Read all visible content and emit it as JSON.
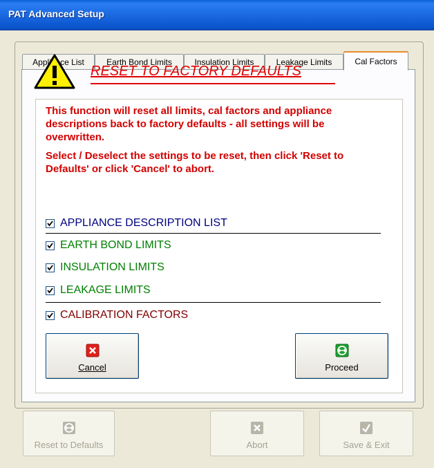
{
  "window": {
    "title": "PAT Advanced Setup"
  },
  "tabs": [
    {
      "label": "Appliance List",
      "active": false
    },
    {
      "label": "Earth Bond Limits",
      "active": false
    },
    {
      "label": "Insulation Limits",
      "active": false
    },
    {
      "label": "Leakage Limits",
      "active": false
    },
    {
      "label": "Cal Factors",
      "active": true
    }
  ],
  "panel": {
    "heading": "RESET TO FACTORY DEFAULTS",
    "message1": "This function will reset all limits, cal factors and appliance descriptions back to factory defaults - all settings will be overwritten.",
    "message2": "Select / Deselect the settings to be reset, then click 'Reset to Defaults' or click 'Cancel' to abort.",
    "options": [
      {
        "label": "APPLIANCE DESCRIPTION LIST",
        "checked": true,
        "color": "#000080"
      },
      {
        "label": "EARTH BOND LIMITS",
        "checked": true,
        "color": "#008000"
      },
      {
        "label": "INSULATION LIMITS",
        "checked": true,
        "color": "#008000"
      },
      {
        "label": "LEAKAGE LIMITS",
        "checked": true,
        "color": "#008000"
      },
      {
        "label": "CALIBRATION FACTORS",
        "checked": true,
        "color": "#800000"
      }
    ],
    "cancel_label": "Cancel",
    "proceed_label": "Proceed"
  },
  "footer": {
    "reset_label": "Reset to Defaults",
    "abort_label": "Abort",
    "save_label": "Save & Exit"
  },
  "colors": {
    "warning_red": "#d10000",
    "cancel_icon": "#e0201a",
    "proceed_icon": "#1ea030"
  }
}
